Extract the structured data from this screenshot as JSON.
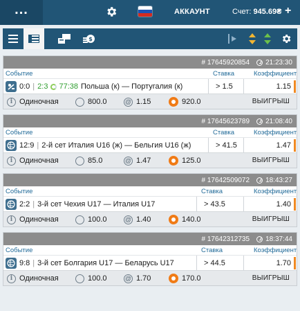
{
  "topbar": {
    "menu_label": "...",
    "account_label": "АККАУНТ",
    "balance_label": "Счет:",
    "balance_value": "945.69₴",
    "add_label": "+"
  },
  "columns": {
    "event": "Событие",
    "stake": "Ставка",
    "coef": "Коэффициент"
  },
  "colors": {
    "primary": "#215576",
    "header": "#8c8c8c",
    "live": "#2e9d2e",
    "accent": "#f08a24"
  },
  "bets": [
    {
      "id": "# 17645920854",
      "time": "21:23:30",
      "sport_icon": "hockey-icon",
      "score": "0:0",
      "live_score": "2:3",
      "live_time": "77:38",
      "event": "Польша (к) — Португалия (к)",
      "stake_bet": "> 1.5",
      "coef": "1.15",
      "type": "Одиночная",
      "amount": "800.0",
      "odds": "1.15",
      "payout": "920.0",
      "result": "ВЫИГРЫШ"
    },
    {
      "id": "# 17645623789",
      "time": "21:08:40",
      "sport_icon": "volleyball-icon",
      "score": "12:9",
      "event": "2-й сет Италия U16 (ж) — Бельгия U16 (ж)",
      "stake_bet": "> 41.5",
      "coef": "1.47",
      "type": "Одиночная",
      "amount": "85.0",
      "odds": "1.47",
      "payout": "125.0",
      "result": "ВЫИГРЫШ"
    },
    {
      "id": "# 17642509072",
      "time": "18:43:27",
      "sport_icon": "volleyball-icon",
      "score": "2:2",
      "event": "3-й сет Чехия U17 — Италия U17",
      "stake_bet": "> 43.5",
      "coef": "1.40",
      "type": "Одиночная",
      "amount": "100.0",
      "odds": "1.40",
      "payout": "140.0",
      "result": "ВЫИГРЫШ"
    },
    {
      "id": "# 17642312735",
      "time": "18:37:44",
      "sport_icon": "volleyball-icon",
      "score": "9:8",
      "event": "3-й сет Болгария U17 — Беларусь U17",
      "stake_bet": "> 44.5",
      "coef": "1.70",
      "type": "Одиночная",
      "amount": "100.0",
      "odds": "1.70",
      "payout": "170.0",
      "result": "ВЫИГРЫШ"
    }
  ]
}
